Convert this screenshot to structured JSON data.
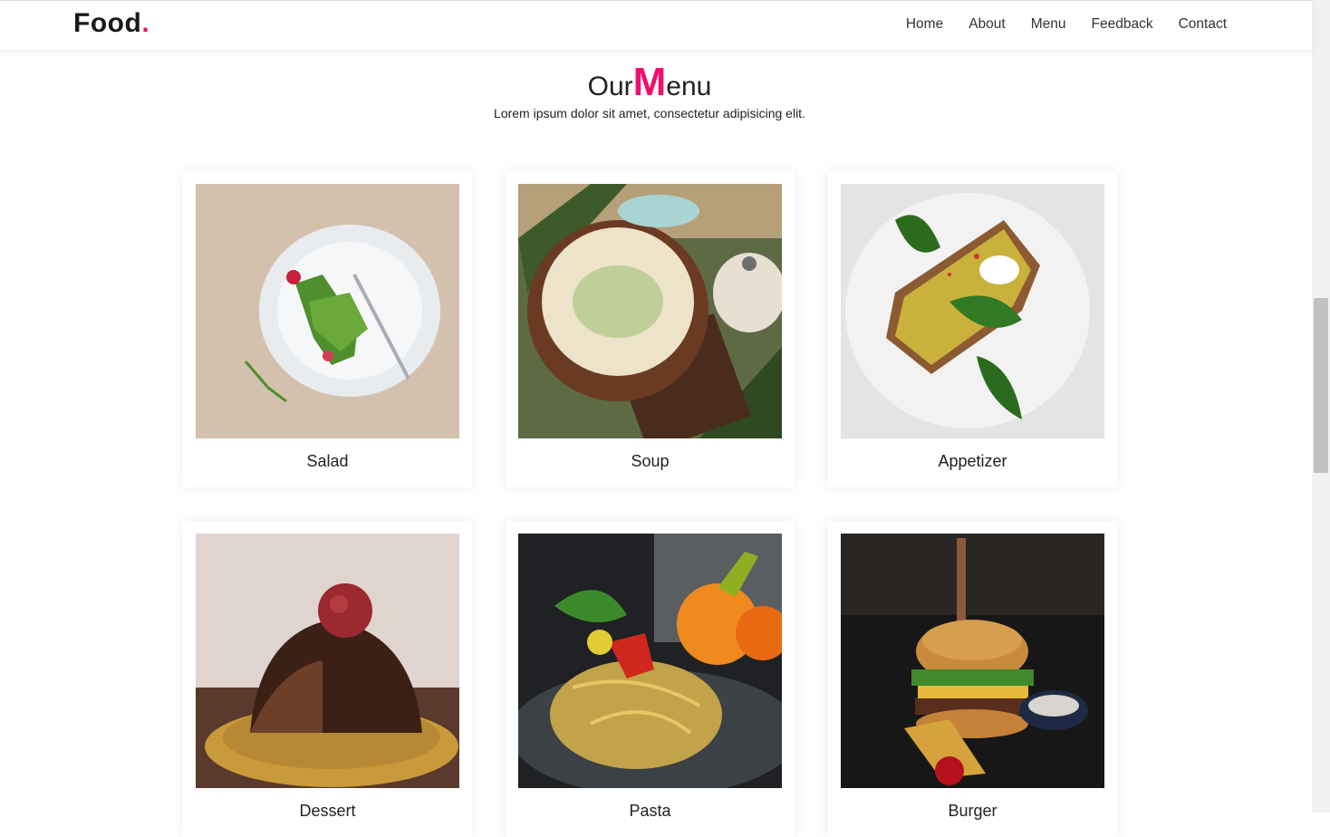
{
  "brand": {
    "name": "Food",
    "dot": "."
  },
  "nav": {
    "items": [
      "Home",
      "About",
      "Menu",
      "Feedback",
      "Contact"
    ]
  },
  "section": {
    "title_prefix": "Our",
    "title_big": "M",
    "title_suffix": "enu",
    "subtitle": "Lorem ipsum dolor sit amet, consectetur adipisicing elit."
  },
  "menu": {
    "items": [
      {
        "label": "Salad"
      },
      {
        "label": "Soup"
      },
      {
        "label": "Appetizer"
      },
      {
        "label": "Dessert"
      },
      {
        "label": "Pasta"
      },
      {
        "label": "Burger"
      }
    ]
  },
  "colors": {
    "accent": "#f00e6e"
  }
}
